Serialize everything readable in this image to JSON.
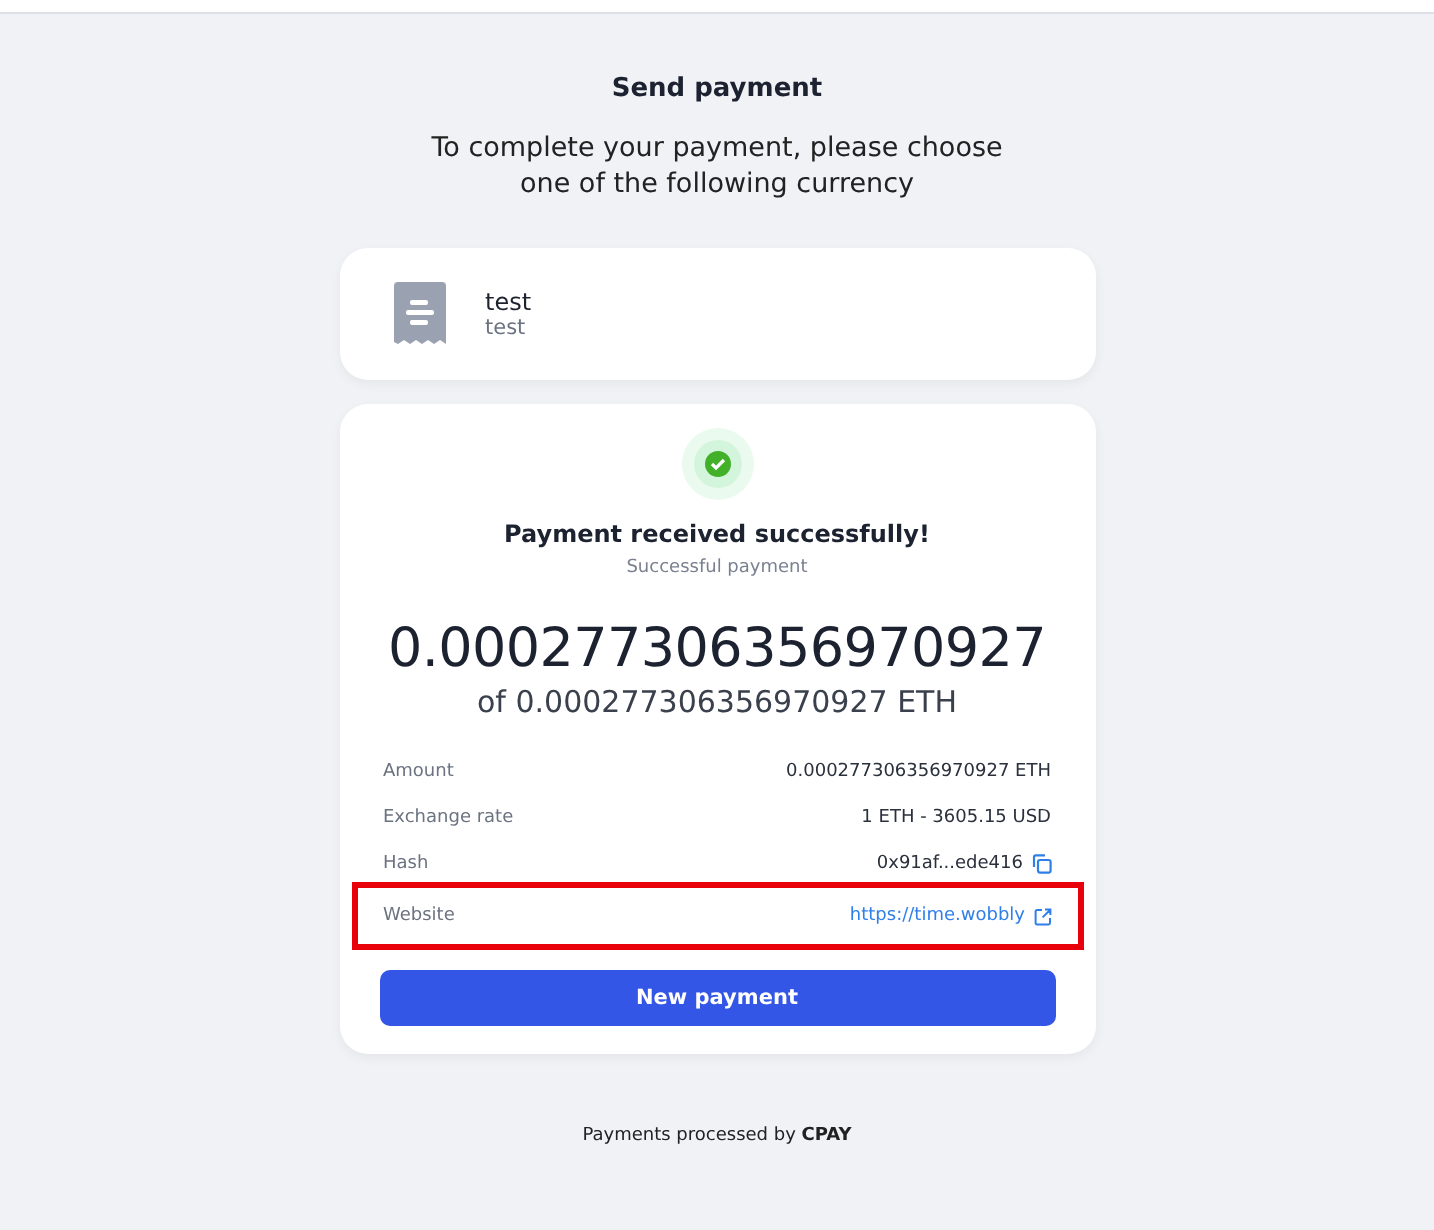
{
  "title": "Send payment",
  "subtitle": "To complete your payment, please choose one of the following currency",
  "invoice": {
    "name": "test",
    "description": "test"
  },
  "status": {
    "kind": "success",
    "heading": "Payment received successfully!",
    "caption": "Successful payment"
  },
  "amount": {
    "paid": "0.000277306356970927",
    "total": "of 0.000277306356970927 ETH"
  },
  "details": [
    {
      "label": "Amount",
      "value": "0.000277306356970927 ETH",
      "kind": "text",
      "highlighted": false
    },
    {
      "label": "Exchange rate",
      "value": "1 ETH - 3605.15 USD",
      "kind": "text",
      "highlighted": false
    },
    {
      "label": "Hash",
      "value": "0x91af...ede416",
      "kind": "copy",
      "highlighted": false
    },
    {
      "label": "Website",
      "value": "https://time.wobbly",
      "kind": "link",
      "highlighted": true
    }
  ],
  "button": "New payment",
  "footer": "Payments processed by **CPAY**"
}
